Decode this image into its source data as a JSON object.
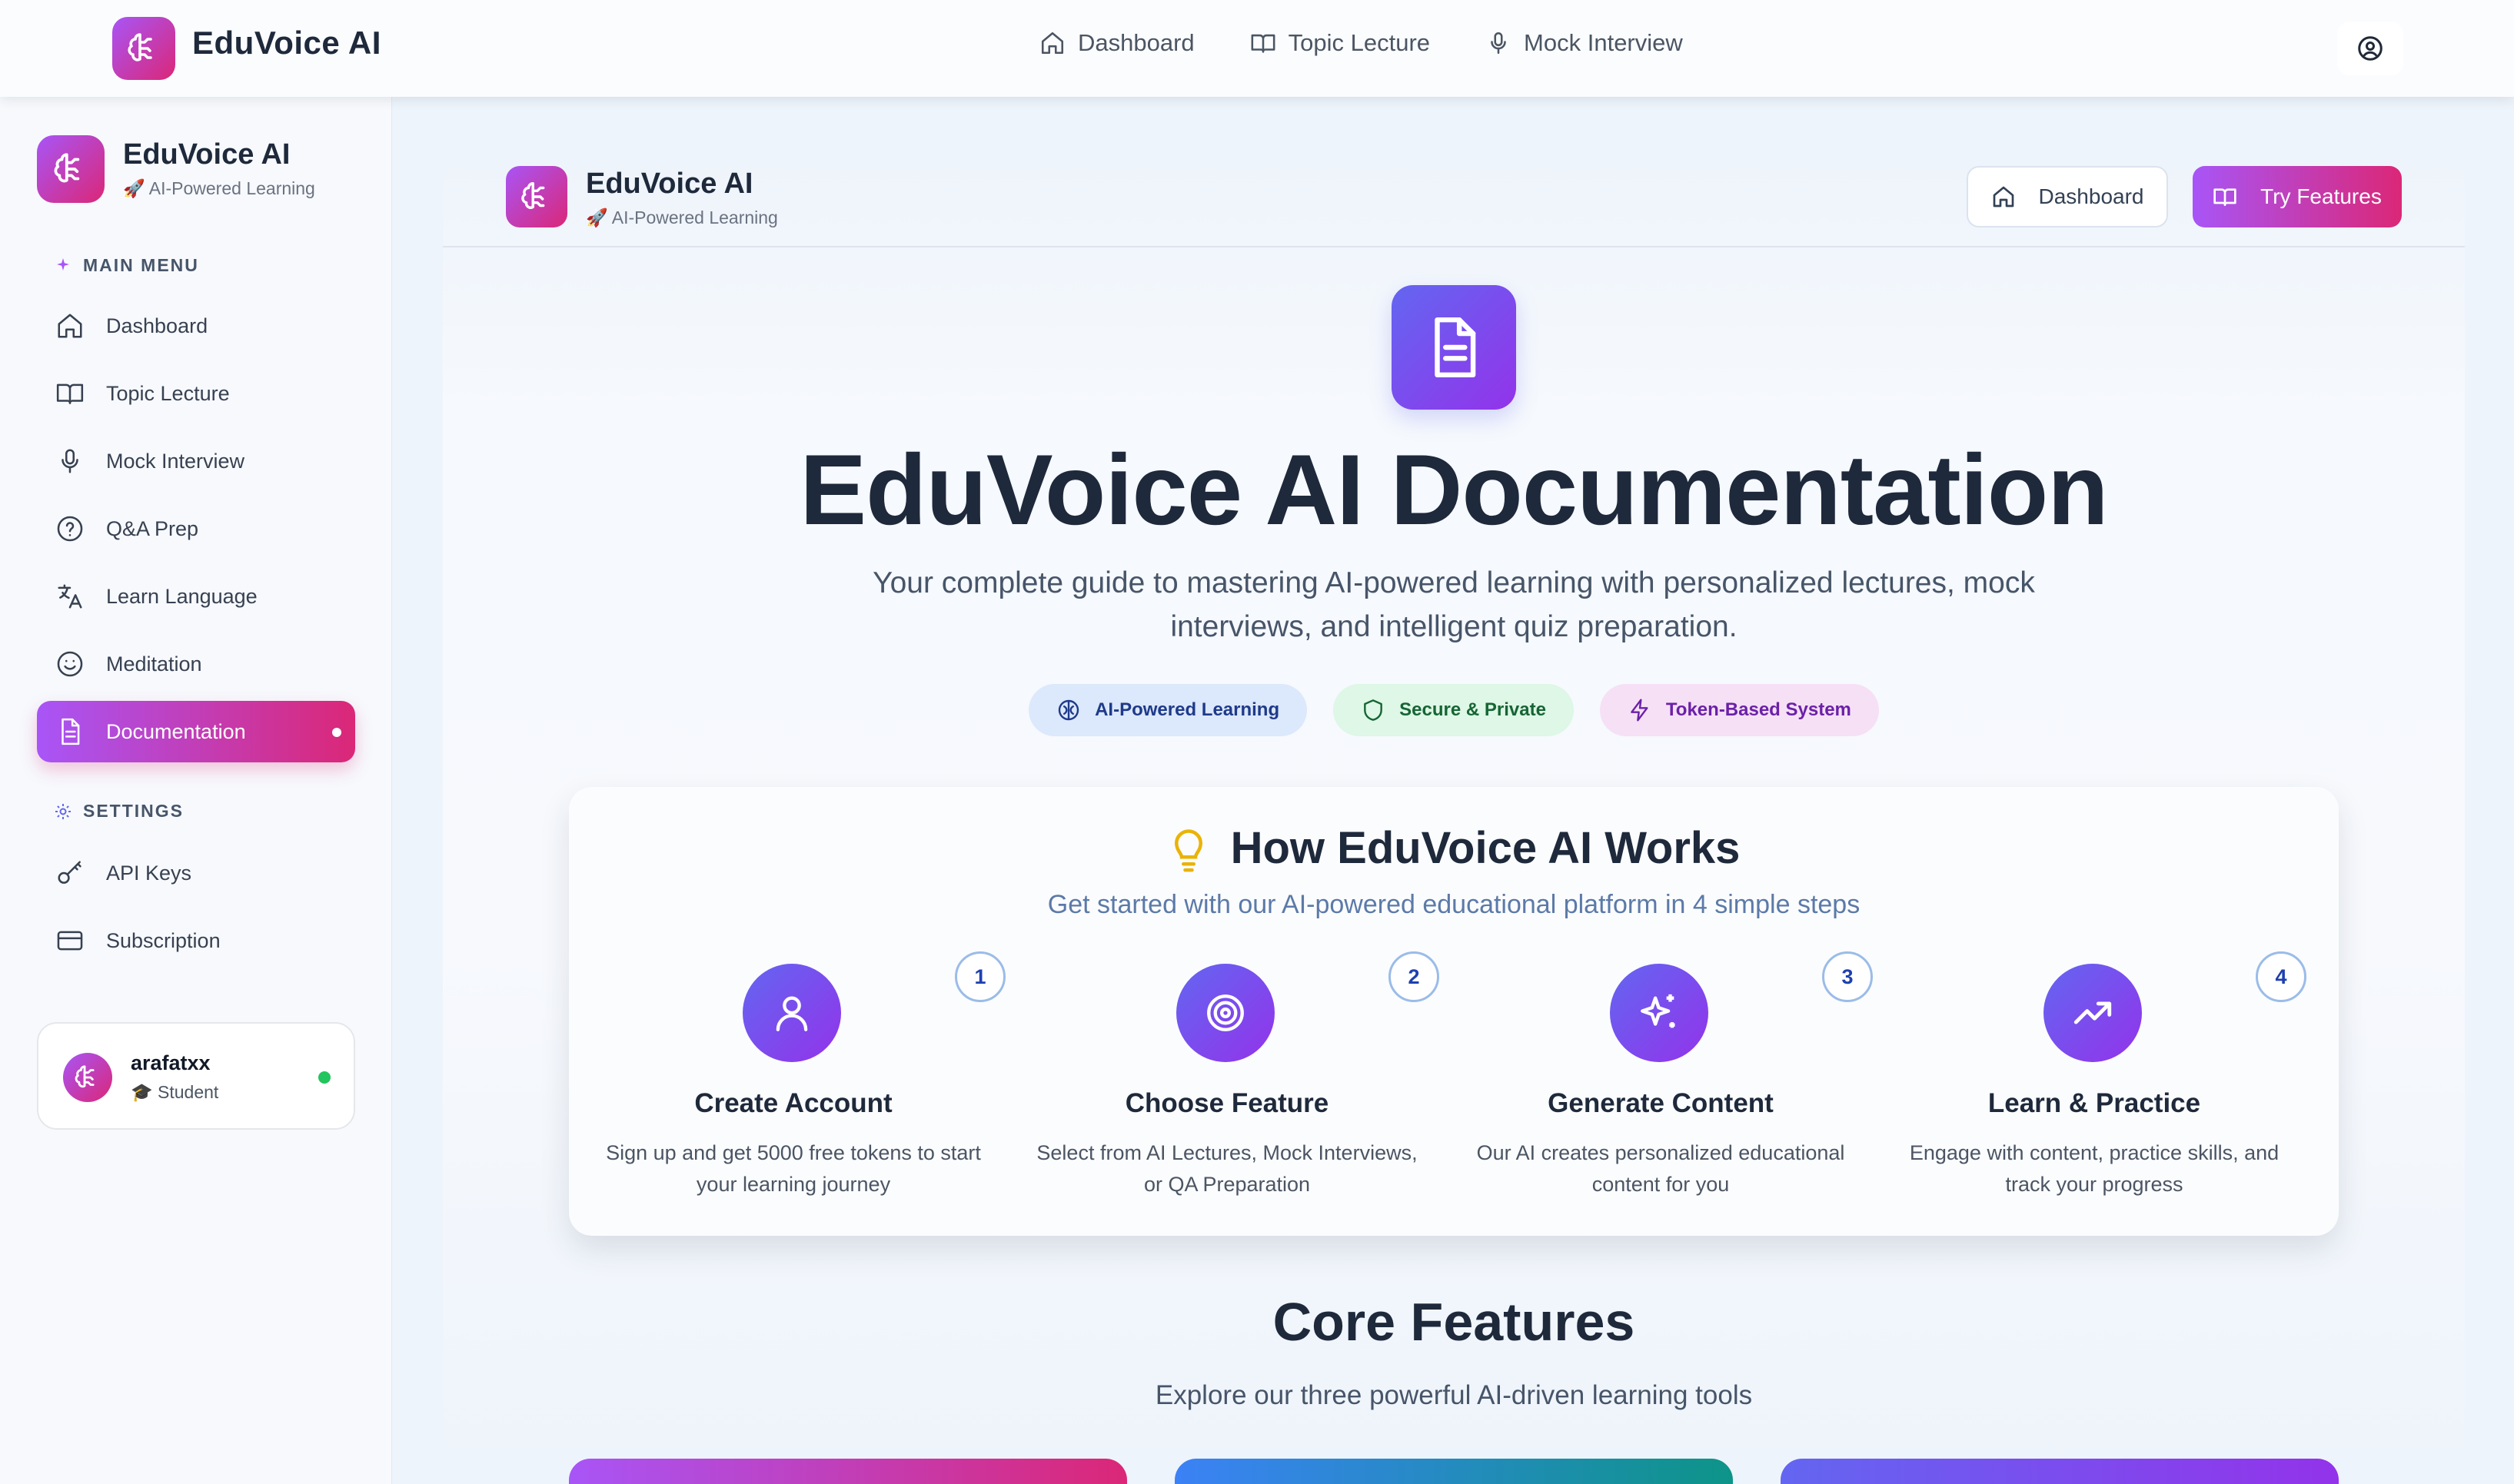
{
  "app": {
    "name": "EduVoice AI",
    "tagline": "🚀 AI-Powered Learning",
    "accent_gradient": [
      "#a855f7",
      "#db2777"
    ],
    "step_gradient": [
      "#6366f1",
      "#9333ea"
    ]
  },
  "topnav": {
    "items": [
      {
        "label": "Dashboard",
        "icon": "home-icon"
      },
      {
        "label": "Topic Lecture",
        "icon": "book-open-icon"
      },
      {
        "label": "Mock Interview",
        "icon": "microphone-icon"
      }
    ],
    "user_icon": "user-circle-icon"
  },
  "sidebar": {
    "main_menu_title": "MAIN MENU",
    "settings_title": "SETTINGS",
    "items": [
      {
        "label": "Dashboard",
        "icon": "home-icon"
      },
      {
        "label": "Topic Lecture",
        "icon": "book-open-icon"
      },
      {
        "label": "Mock Interview",
        "icon": "microphone-icon"
      },
      {
        "label": "Q&A Prep",
        "icon": "question-circle-icon"
      },
      {
        "label": "Learn Language",
        "icon": "translate-icon"
      },
      {
        "label": "Meditation",
        "icon": "smile-icon"
      },
      {
        "label": "Documentation",
        "icon": "document-icon",
        "active": true
      }
    ],
    "settings_items": [
      {
        "label": "API Keys",
        "icon": "key-icon"
      },
      {
        "label": "Subscription",
        "icon": "credit-card-icon"
      }
    ],
    "user": {
      "name": "arafatxx",
      "role": "🎓 Student",
      "status_color": "#22c55e"
    }
  },
  "header": {
    "dashboard_button": "Dashboard",
    "try_button": "Try Features"
  },
  "hero": {
    "title": "EduVoice AI Documentation",
    "subtitle": "Your complete guide to mastering AI-powered learning with personalized lectures, mock interviews, and intelligent quiz preparation.",
    "chips": [
      {
        "label": "AI-Powered Learning",
        "icon": "brain-icon",
        "color": "#dce8fb"
      },
      {
        "label": "Secure & Private",
        "icon": "shield-icon",
        "color": "#def7e6"
      },
      {
        "label": "Token-Based System",
        "icon": "lightning-icon",
        "color": "#f6e0f5"
      }
    ]
  },
  "how_it_works": {
    "title": "How EduVoice AI Works",
    "subtitle": "Get started with our AI-powered educational platform in 4 simple steps",
    "steps": [
      {
        "number": "1",
        "title": "Create Account",
        "description": "Sign up and get 5000 free tokens to start your learning journey",
        "icon": "user-icon"
      },
      {
        "number": "2",
        "title": "Choose Feature",
        "description": "Select from AI Lectures, Mock Interviews, or QA Preparation",
        "icon": "target-icon"
      },
      {
        "number": "3",
        "title": "Generate Content",
        "description": "Our AI creates personalized educational content for you",
        "icon": "sparkles-icon"
      },
      {
        "number": "4",
        "title": "Learn & Practice",
        "description": "Engage with content, practice skills, and track your progress",
        "icon": "trending-up-icon"
      }
    ]
  },
  "core_features": {
    "title": "Core Features",
    "subtitle": "Explore our three powerful AI-driven learning tools"
  }
}
